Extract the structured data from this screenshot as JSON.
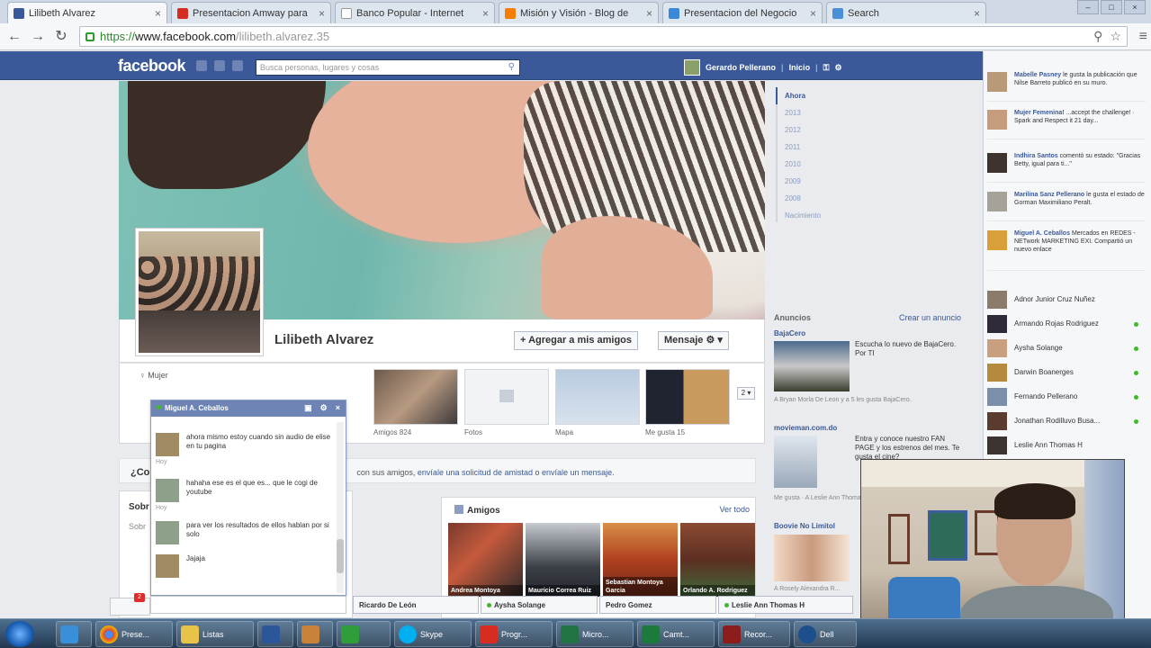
{
  "browser": {
    "tabs": [
      {
        "label": "Lilibeth Alvarez",
        "color": "#3b5998",
        "active": true
      },
      {
        "label": "Presentacion Amway para",
        "color": "#d62d20"
      },
      {
        "label": "Banco Popular - Internet",
        "color": "#ffffff"
      },
      {
        "label": "Misión y Visión - Blog de",
        "color": "#f57d00"
      },
      {
        "label": "Presentacion del Negocio",
        "color": "#3a89d9"
      },
      {
        "label": "Search",
        "color": "#4a90d9"
      }
    ],
    "url_scheme": "https://",
    "url_host": "www.facebook.com",
    "url_path": "/lilibeth.alvarez.35"
  },
  "fb": {
    "logo": "facebook",
    "search_placeholder": "Busca personas, lugares y cosas",
    "user_name": "Gerardo Pellerano",
    "home_label": "Inicio",
    "profile_name": "Lilibeth Alvarez",
    "add_friend_label": "+ Agregar a mis amigos",
    "message_label": "Mensaje",
    "gender": "Mujer",
    "apps": [
      {
        "label": "Amigos 824"
      },
      {
        "label": "Fotos"
      },
      {
        "label": "Mapa"
      },
      {
        "label": "Me gusta 15"
      }
    ],
    "more_label": "2",
    "friend_request_title": "¿Co",
    "friend_request_text": "con sus amigos, ",
    "friend_request_link1": "envíale una solicitud de amistad",
    "friend_request_or": " o ",
    "friend_request_link2": "envíale un mensaje.",
    "left_box_title": "Sobr",
    "left_box_sub": "Sobr",
    "amigos_title": "Amigos",
    "amigos_all": "Ver todo",
    "friends": [
      {
        "name": "Andrea Montoya"
      },
      {
        "name": "Mauricio Correa Ruiz"
      },
      {
        "name": "Sebastian Montoya Garcia"
      },
      {
        "name": "Orlando A. Rodriguez"
      }
    ],
    "timeline_years": [
      "Ahora",
      "2013",
      "2012",
      "2011",
      "2010",
      "2009",
      "2008",
      "Nacimiento"
    ],
    "ads_header": "Anuncios",
    "ads_create": "Crear un anuncio",
    "ads": [
      {
        "title": "BajaCero",
        "text": "Escucha lo nuevo de BajaCero. Por TI",
        "small": "A Bryan Morla De Leon y a 5 les gusta BajaCero."
      },
      {
        "title": "movieman.com.do",
        "text": "Entra y conoce nuestro FAN PAGE y los estrenos del mes. Te gusta el cine?",
        "small": "Me gusta · A Leslie Ann Thomas le gusta movieman.com.do."
      },
      {
        "title": "Boovie No Limitol",
        "text": "",
        "small": "A Rosely Alexandra R..."
      }
    ],
    "chat": {
      "name": "Miguel A. Ceballos",
      "messages": [
        {
          "text": "ahora mismo estoy cuando sin audio de elise en tu pagina",
          "when": "Hoy"
        },
        {
          "text": "hahaha ese es el que es... que le cogi de youtube",
          "when": "Hoy"
        },
        {
          "text": "para ver los resultados de ellos hablan por si solo",
          "when": ""
        },
        {
          "text": "Jajaja",
          "when": ""
        }
      ]
    },
    "chat_notif": "2",
    "chat_tabs": [
      "Ricardo De León",
      "Aysha Solange",
      "Pedro Gomez",
      "Leslie Ann Thomas H"
    ],
    "ticker": [
      {
        "name": "Mabelle Pasney",
        "text": "le gusta la publicación que Nilse Barreto publicó en su muro."
      },
      {
        "name": "Mujer Femenina!",
        "text": "...accept the challenge! · Spark and Respect it 21 day..."
      },
      {
        "name": "Indhira Santos",
        "text": "comentó su estado: \"Gracias Betty, igual para ti...\""
      },
      {
        "name": "Marilina Sanz Pellerano",
        "text": "le gusta el estado de Gorman Maximiliano Peralt."
      },
      {
        "name": "Miguel A. Ceballos",
        "text": "Mercados en REDES - NETwork MARKETING EXI. Compartió un nuevo enlace"
      }
    ],
    "buddies": [
      "Adnor Junior Cruz Nuñez",
      "Armando Rojas Rodriguez",
      "Aysha Solange",
      "Darwin Boanerges",
      "Fernando Pellerano",
      "Jonathan Rodilluvo Busa...",
      "Leslie Ann Thomas H"
    ]
  },
  "taskbar": {
    "items": [
      {
        "label": "Prese...",
        "color": "#d9302c"
      },
      {
        "label": "Listas",
        "color": "#e8c34a"
      },
      {
        "label": "",
        "color": "#2b579a"
      },
      {
        "label": "",
        "color": "#c9823a"
      },
      {
        "label": "",
        "color": "#2e9d3a"
      },
      {
        "label": "Skype",
        "color": "#00aff0"
      },
      {
        "label": "Progr...",
        "color": "#d62d20"
      },
      {
        "label": "Micro...",
        "color": "#217346"
      },
      {
        "label": "Camt...",
        "color": "#1b7a3c"
      },
      {
        "label": "Recor...",
        "color": "#8c1d1d"
      },
      {
        "label": "Dell",
        "color": "#1d4f8c"
      }
    ]
  }
}
